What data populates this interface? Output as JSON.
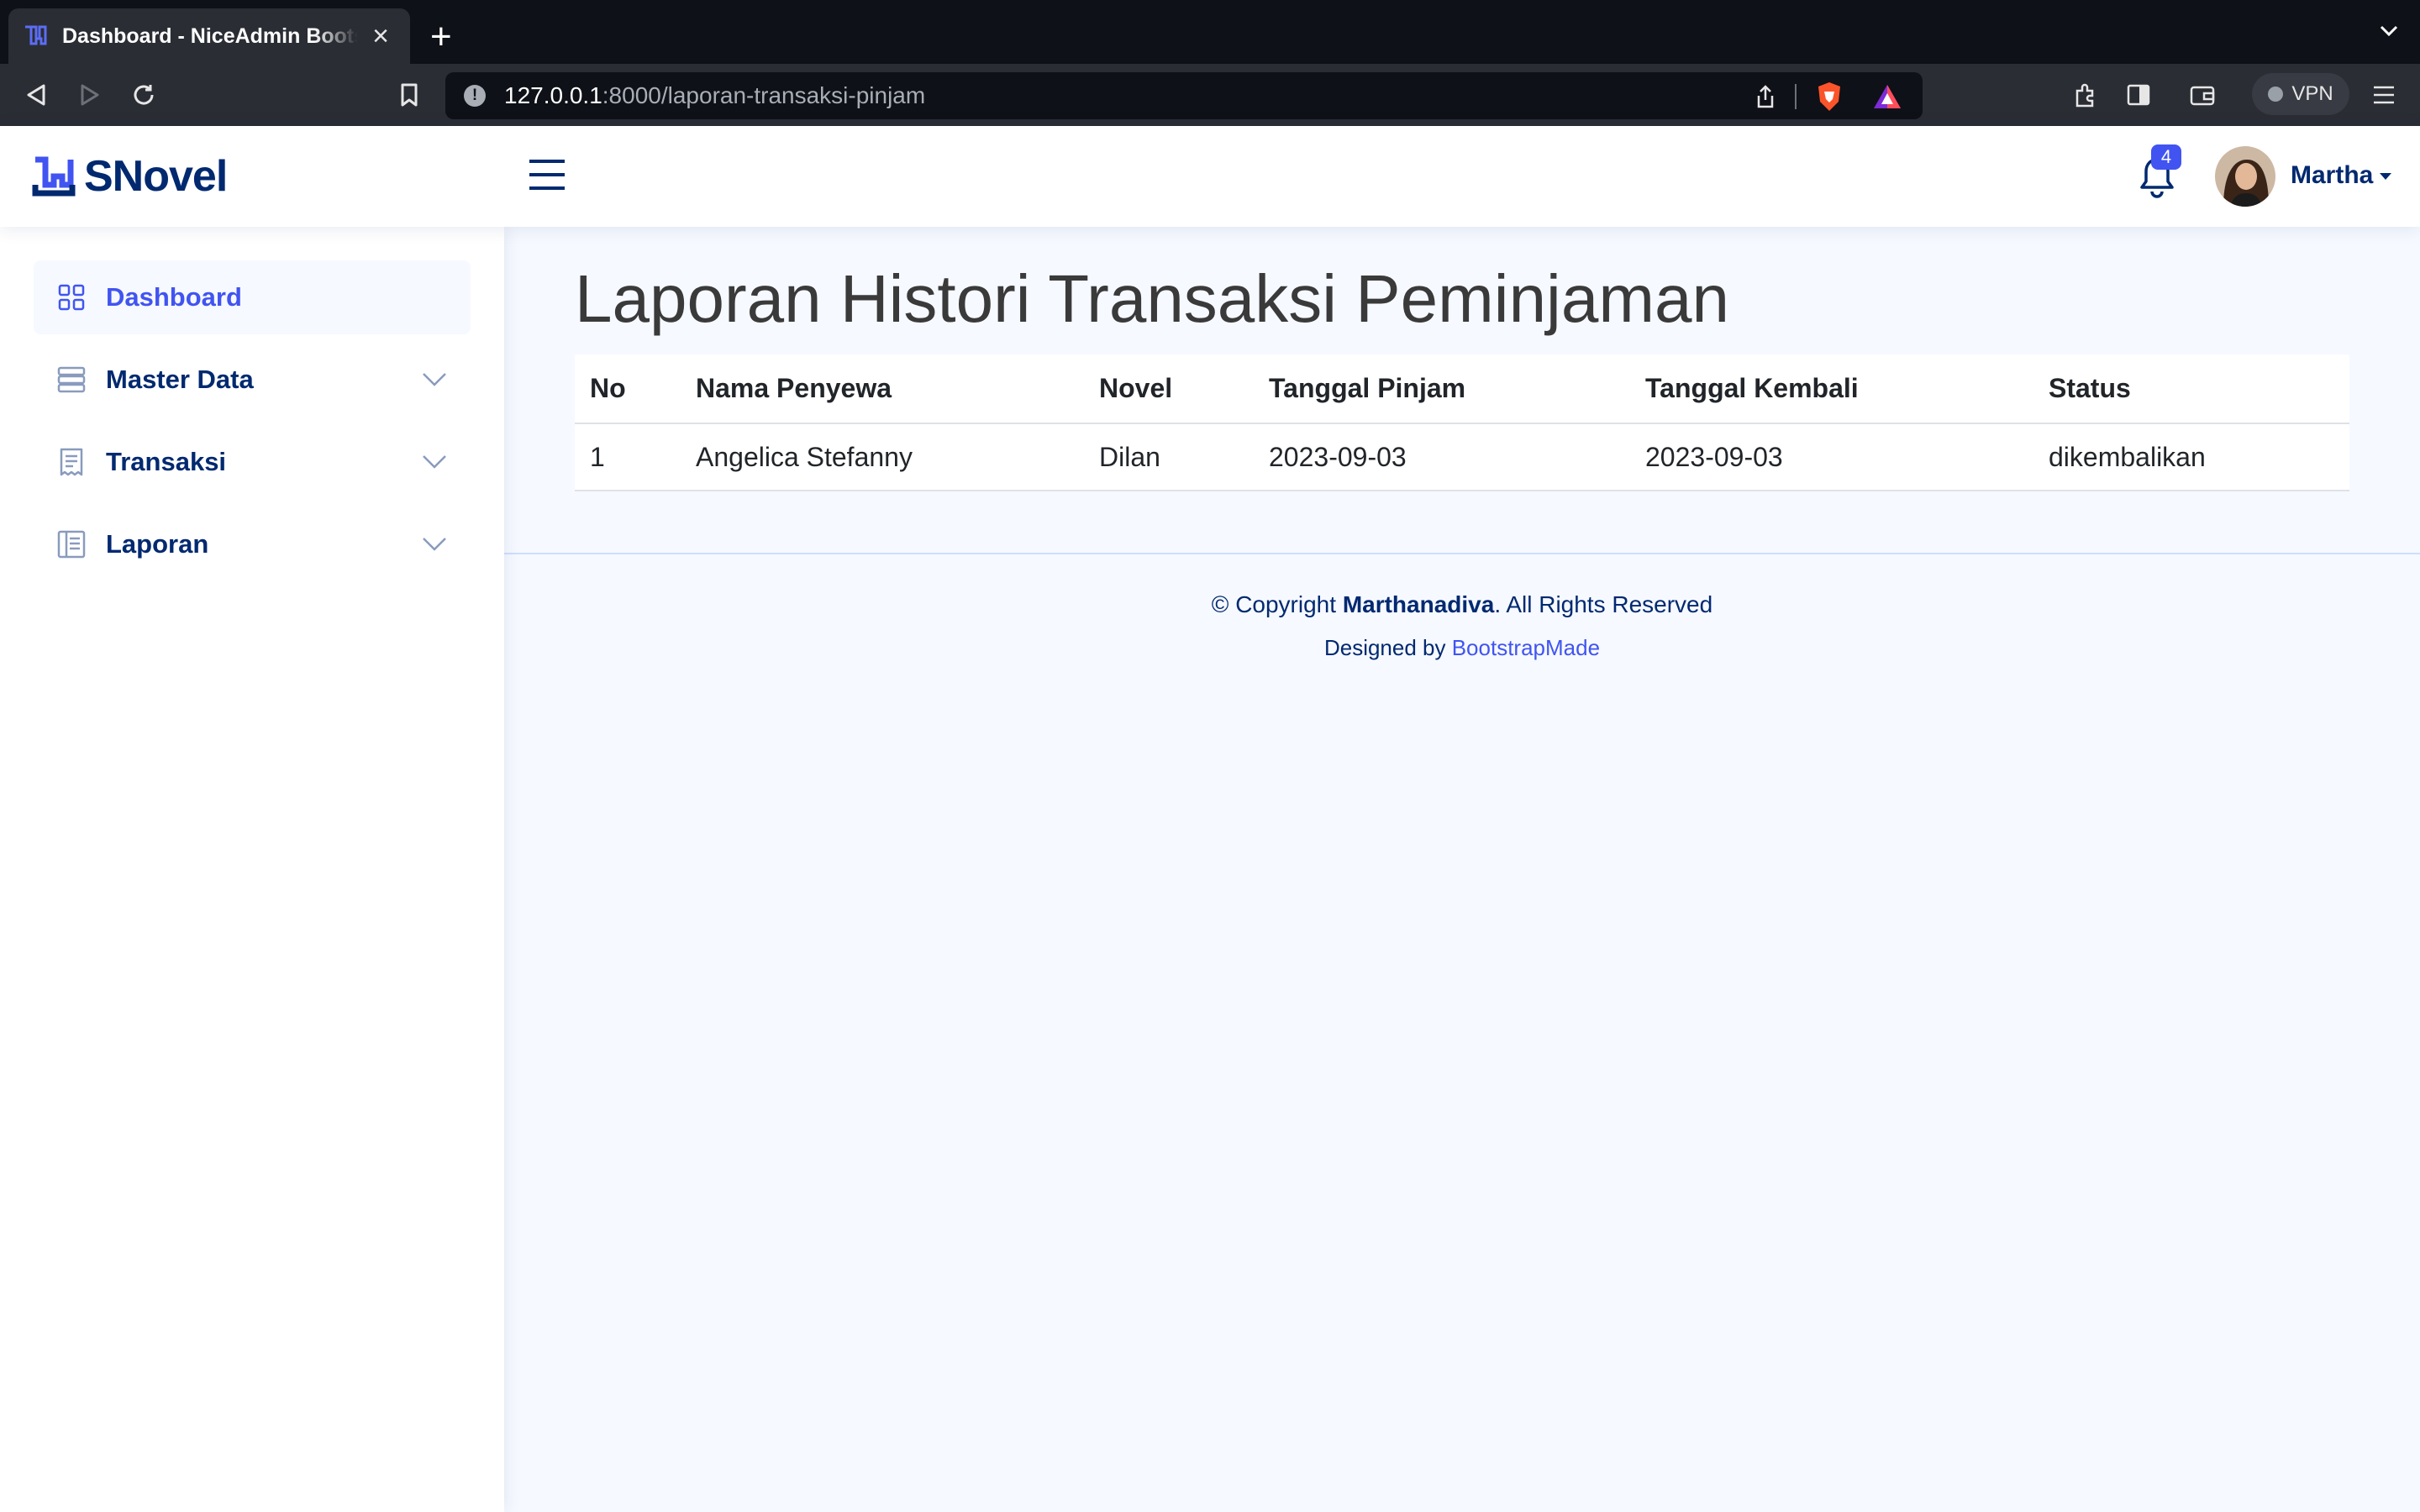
{
  "browser": {
    "tab_title": "Dashboard - NiceAdmin Bootstrap Template",
    "new_tab_label": "+",
    "close_label": "×",
    "url_host": "127.0.0.1",
    "url_path": ":8000/laporan-transaksi-pinjam",
    "vpn_label": "VPN"
  },
  "header": {
    "logo_text": "SNovel",
    "notification_count": "4",
    "profile_name": "Martha"
  },
  "sidebar": {
    "items": [
      {
        "label": "Dashboard",
        "icon": "grid-icon",
        "active": true
      },
      {
        "label": "Master Data",
        "icon": "database-icon",
        "expandable": true
      },
      {
        "label": "Transaksi",
        "icon": "receipt-icon",
        "expandable": true
      },
      {
        "label": "Laporan",
        "icon": "layout-text-icon",
        "expandable": true
      }
    ]
  },
  "main": {
    "title": "Laporan Histori Transaksi Peminjaman",
    "table": {
      "headers": [
        "No",
        "Nama Penyewa",
        "Novel",
        "Tanggal Pinjam",
        "Tanggal Kembali",
        "Status"
      ],
      "rows": [
        [
          "1",
          "Angelica Stefanny",
          "Dilan",
          "2023-09-03",
          "2023-09-03",
          "dikembalikan"
        ]
      ]
    }
  },
  "footer": {
    "copyright_prefix": "© Copyright ",
    "copyright_name": "Marthanadiva",
    "copyright_suffix": ". All Rights Reserved",
    "designed_by": "Designed by ",
    "designer_link": "BootstrapMade"
  },
  "colors": {
    "brand": "#4154f1",
    "navy": "#012970",
    "page_bg": "#f6f9ff",
    "browser_dark": "#0e1117",
    "browser_toolbar": "#2a2d34"
  }
}
